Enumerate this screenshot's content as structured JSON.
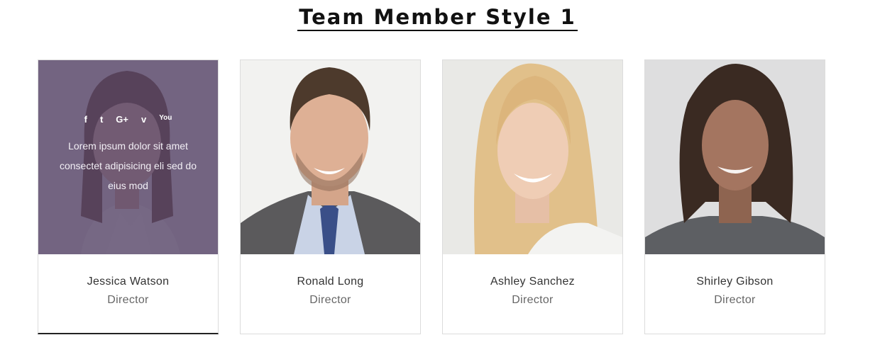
{
  "heading": "Team Member Style 1",
  "members": [
    {
      "name": "Jessica Watson",
      "role": "Director",
      "bio": "Lorem ipsum dolor sit amet consectet adipisicing eli sed do eius mod",
      "social_icons": [
        "facebook-icon",
        "twitter-icon",
        "google-plus-icon",
        "vimeo-icon",
        "youtube-icon"
      ],
      "social_glyphs": [
        "f",
        "t",
        "G+",
        "v",
        "You"
      ]
    },
    {
      "name": "Ronald Long",
      "role": "Director"
    },
    {
      "name": "Ashley Sanchez",
      "role": "Director"
    },
    {
      "name": "Shirley Gibson",
      "role": "Director"
    }
  ],
  "colors": {
    "overlay": "#524064",
    "heading": "#111111",
    "name_text": "#333333",
    "role_text": "#666666"
  }
}
